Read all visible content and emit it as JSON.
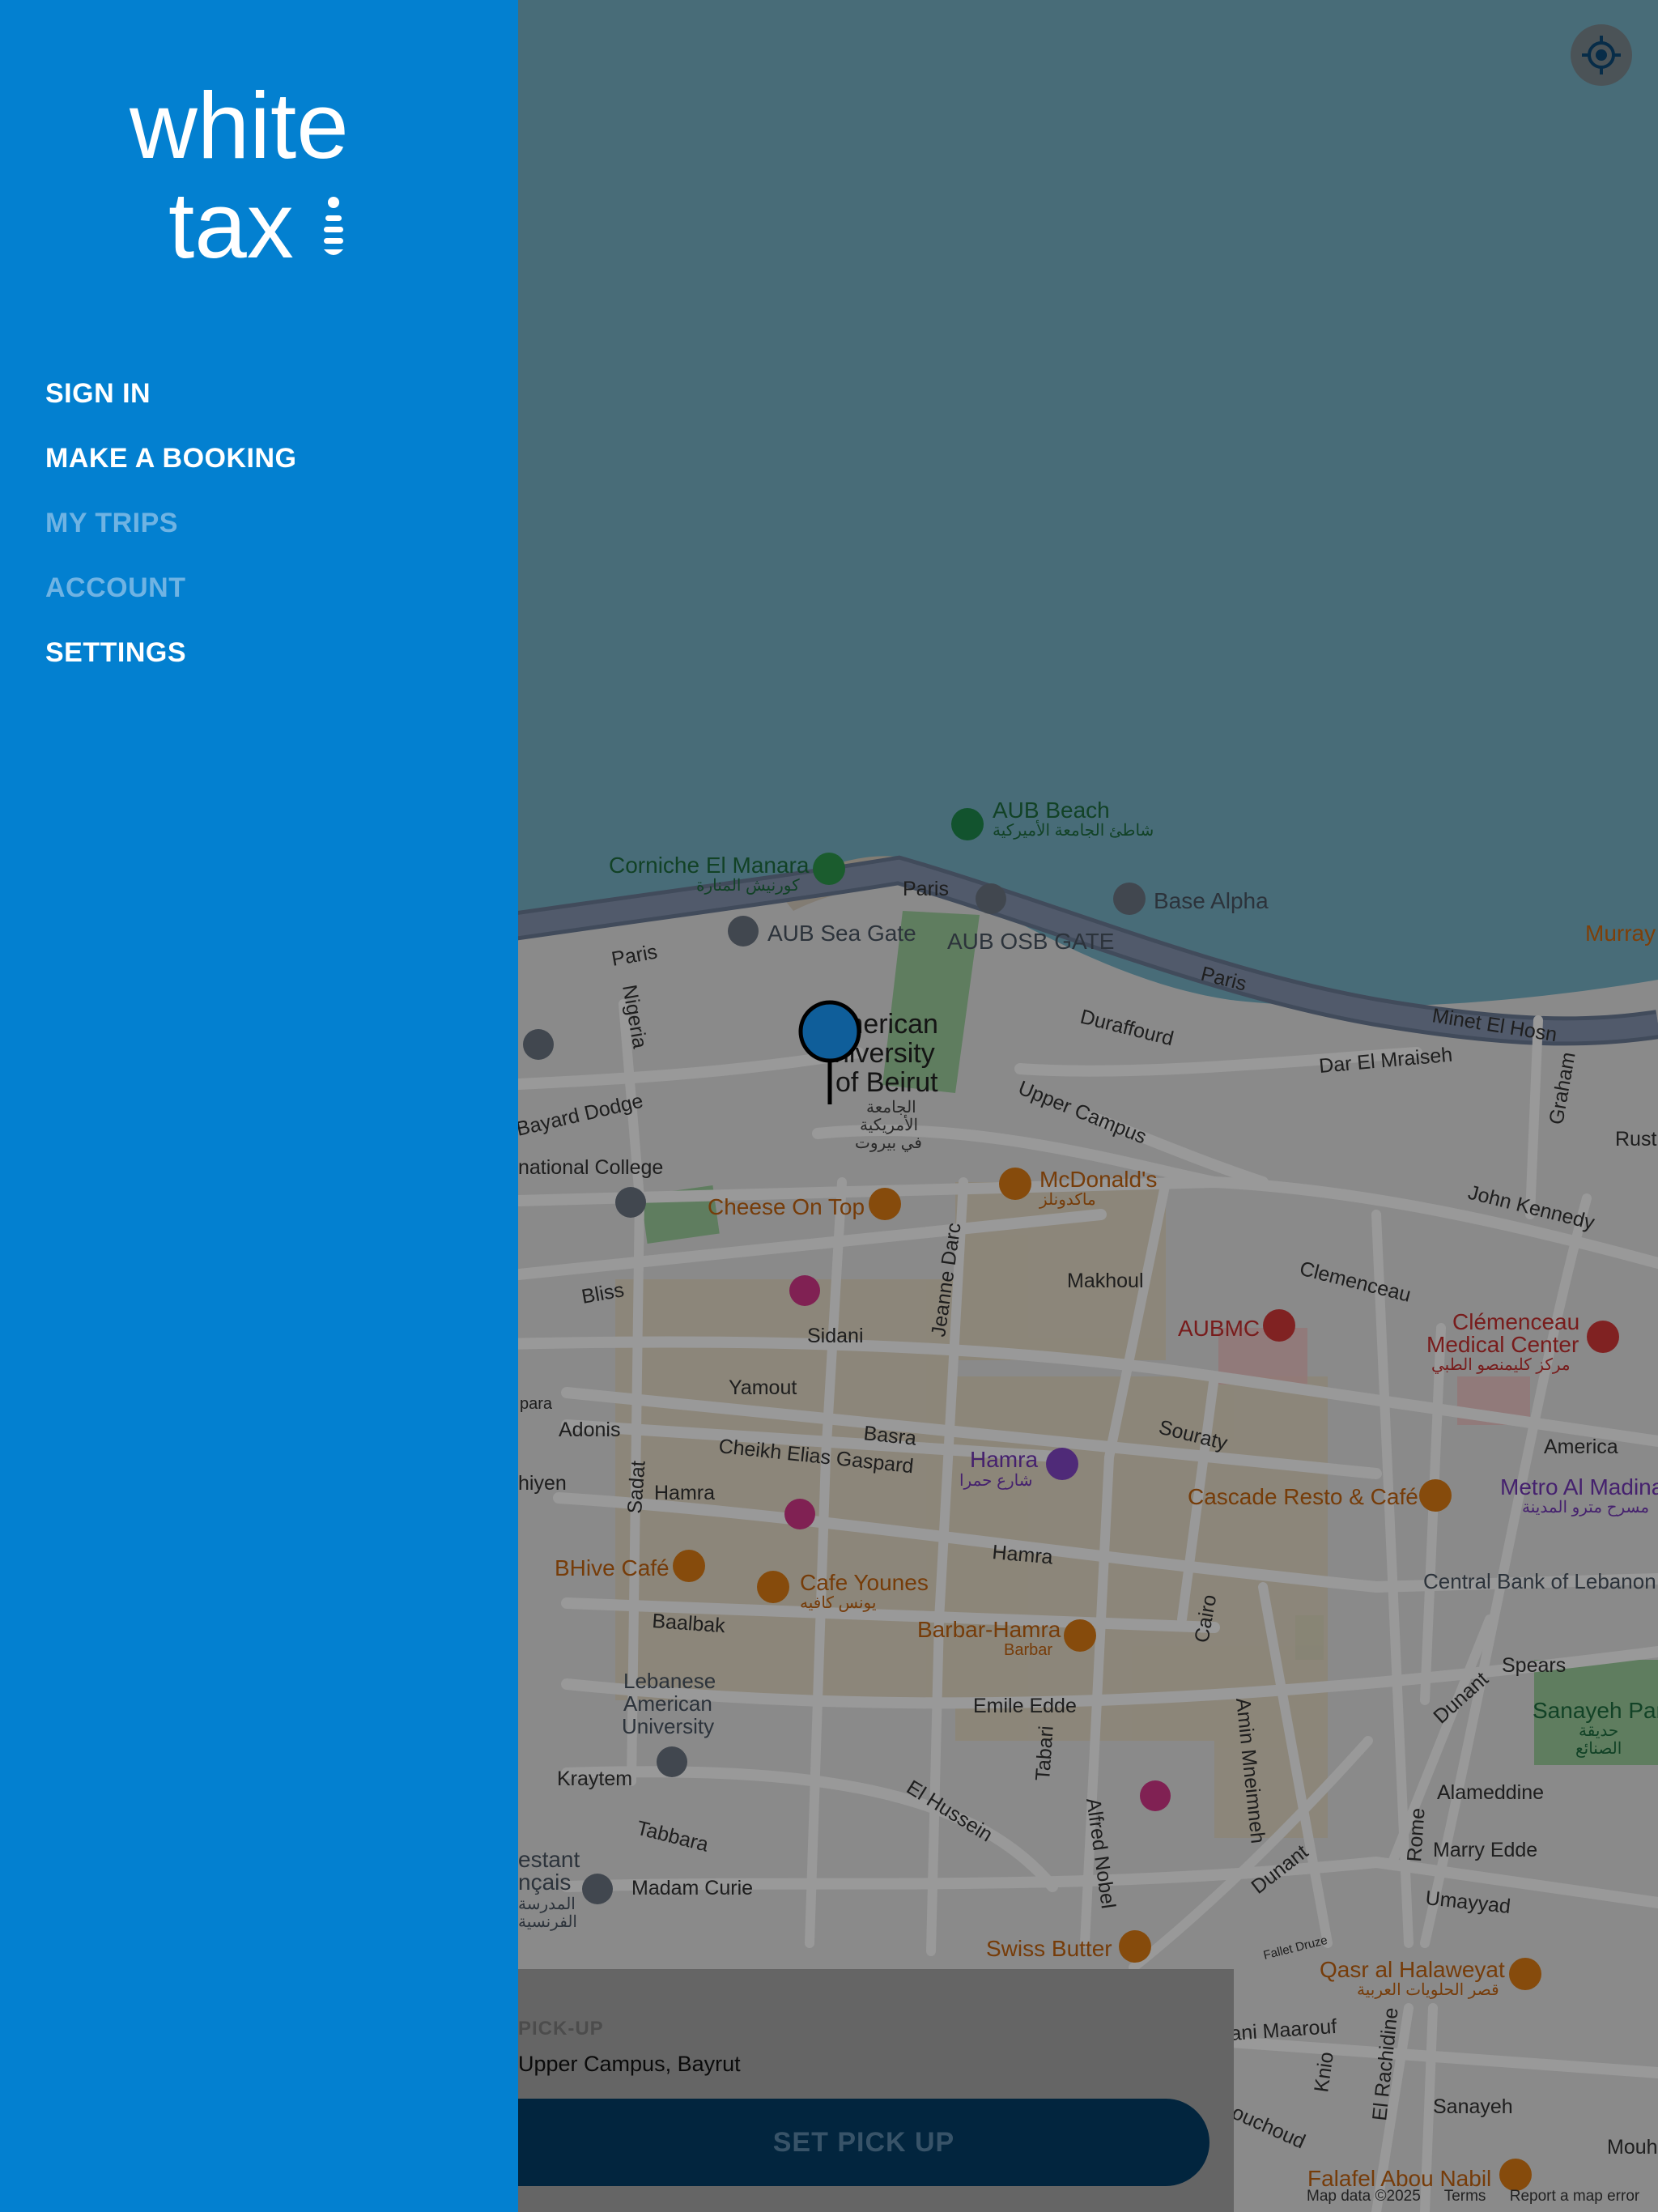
{
  "app": {
    "name": "white taxi"
  },
  "logo": {
    "line1": "white",
    "line2": "tax"
  },
  "menu": {
    "items": [
      {
        "label": "SIGN IN",
        "enabled": true
      },
      {
        "label": "MAKE A BOOKING",
        "enabled": true
      },
      {
        "label": "MY TRIPS",
        "enabled": false
      },
      {
        "label": "ACCOUNT",
        "enabled": false
      },
      {
        "label": "SETTINGS",
        "enabled": true
      }
    ]
  },
  "map": {
    "streets": {
      "paris_1": "Paris",
      "paris_2": "Paris",
      "paris_3": "Paris",
      "minet": "Minet El Hosn",
      "durraffourd": "Duraffourd",
      "dar": "Dar El Mraiseh",
      "nigeria": "Nigeria",
      "bayard": "Bayard Dodge",
      "upper_campus": "Upper Campus",
      "john_kennedy": "John Kennedy",
      "clemenceau": "Clemenceau",
      "bliss": "Bliss",
      "makhoul": "Makhoul",
      "jeanne": "Jeanne Darc",
      "sidani": "Sidani",
      "yamout": "Yamout",
      "basra": "Basra",
      "adonis": "Adonis",
      "cheikh": "Cheikh Elias Gaspard",
      "souraty": "Souraty",
      "hamra_st_1": "Hamra",
      "hamra_st_2": "Hamra",
      "sadat": "Sadat",
      "baalbak": "Baalbak",
      "cairo": "Cairo",
      "emile": "Emile Edde",
      "spears": "Spears",
      "dunant_1": "Dunant",
      "dunant_2": "Dunant",
      "amin": "Amin Mneimneh",
      "alameddine": "Alameddine",
      "marry": "Marry Edde",
      "umayyad": "Umayyad",
      "rome": "Rome",
      "tabari": "Tabari",
      "kraytem": "Kraytem",
      "tabbara": "Tabbara",
      "madam": "Madam Curie",
      "hussein": "El Hussein",
      "alfred": "Alfred Nobel",
      "america": "America",
      "graham": "Graham",
      "rust": "Rust",
      "ani": "ani Maarouf",
      "knio": "Knio",
      "rachidine": "El Rachidine",
      "sanayeh_st": "Sanayeh",
      "mouhi": "Mouhi",
      "chouchod": "ouchoud",
      "nat_college": "national College",
      "hiyen": "hiyen",
      "para": "para"
    },
    "places": {
      "aub_beach": "AUB Beach",
      "aub_beach_ar": "شاطئ الجامعة الأميركية",
      "corniche": "Corniche El Manara",
      "corniche_ar": "كورنيش المنارة",
      "aub_sea_gate": "AUB Sea Gate",
      "aub_osb_gate": "AUB OSB GATE",
      "base_alpha": "Base Alpha",
      "murray": "Murray",
      "aub_1": "merican",
      "aub_2": "niversity",
      "aub_3": "of Beirut",
      "aub_ar1": "الجامعة",
      "aub_ar2": "الأمريكية",
      "aub_ar3": "في بيروت",
      "mcdonalds": "McDonald's",
      "mcdonalds_ar": "ماكدونلز",
      "cheese": "Cheese On Top",
      "aubmc": "AUBMC",
      "clemenceau_mc_1": "Clémenceau",
      "clemenceau_mc_2": "Medical Center",
      "clemenceau_mc_ar": "مركز كليمنصو الطبي",
      "hamra": "Hamra",
      "hamra_ar": "شارع حمرا",
      "cascade": "Cascade Resto & Café",
      "metro_1": "Metro Al Madina",
      "metro_ar": "مسرح مترو المدينة",
      "central_bank": "Central Bank of Lebanon",
      "bhive": "BHive Café",
      "cafe_younes": "Cafe Younes",
      "cafe_younes_ar": "يونس كافيه",
      "barbar": "Barbar-Hamra",
      "barbar_sub": "Barbar",
      "lau_1": "Lebanese",
      "lau_2": "American",
      "lau_3": "University",
      "sanayeh_park": "Sanayeh Par",
      "sanayeh_ar1": "حديقة",
      "sanayeh_ar2": "الصنائع",
      "swiss": "Swiss Butter",
      "qasr": "Qasr al Halaweyat",
      "qasr_ar": "قصر الحلويات العربية",
      "falafel": "Falafel Abou Nabil",
      "estant": "estant",
      "ncais": "nçais",
      "lycee_ar1": "المدرسة",
      "lycee_ar2": "الفرنسية",
      "fallet": "Fallet Druze"
    }
  },
  "pickup": {
    "label": "PICK-UP",
    "address": "Upper Campus, Bayrut",
    "button": "SET PICK UP"
  },
  "attribution": {
    "data": "Map data ©2025",
    "terms": "Terms",
    "report": "Report a map error"
  },
  "colors": {
    "sidebar": "#0380d0",
    "button": "#043f68",
    "pin": "#0f5e9a"
  },
  "icons": {
    "locate": "my-location-icon",
    "pin": "map-pin-icon"
  }
}
